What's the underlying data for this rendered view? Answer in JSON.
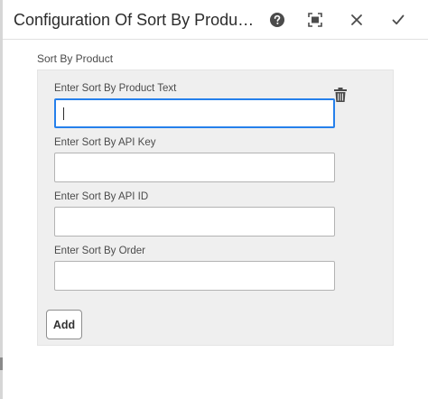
{
  "dialog": {
    "title": "Configuration Of Sort By Product Com...",
    "header_icons": [
      "help-icon",
      "fullscreen-icon",
      "close-icon",
      "checkmark-icon"
    ]
  },
  "section": {
    "label": "Sort By Product"
  },
  "fields": [
    {
      "label": "Enter Sort By Product Text",
      "value": "",
      "placeholder": ""
    },
    {
      "label": "Enter Sort By API Key",
      "value": "",
      "placeholder": ""
    },
    {
      "label": "Enter Sort By API ID",
      "value": "",
      "placeholder": ""
    },
    {
      "label": "Enter Sort By Order",
      "value": "",
      "placeholder": ""
    }
  ],
  "actions": {
    "add_label": "Add",
    "delete_icon": "trash-icon"
  },
  "colors": {
    "focus": "#2680eb",
    "panel_bg": "#efefef",
    "text": "#323232"
  }
}
